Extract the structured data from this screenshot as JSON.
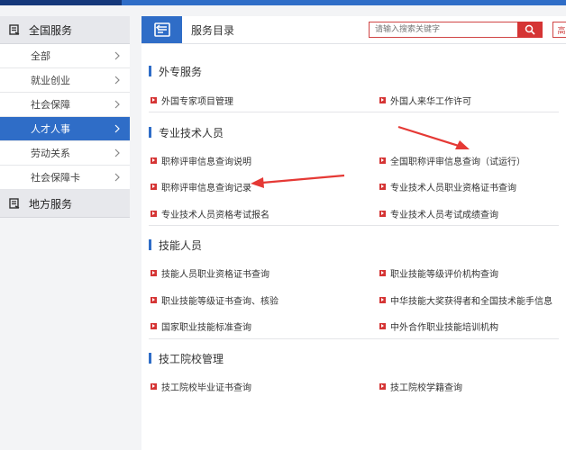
{
  "sidebar": {
    "groups": [
      {
        "label": "全国服务",
        "items": [
          "全部",
          "就业创业",
          "社会保障",
          "人才人事",
          "劳动关系",
          "社会保障卡"
        ]
      },
      {
        "label": "地方服务"
      }
    ],
    "active_item": "人才人事"
  },
  "header": {
    "title": "服务目录",
    "search_placeholder": "请输入搜索关键字",
    "right_button_label": "高"
  },
  "sections": [
    {
      "title": "外专服务",
      "links": [
        "外国专家项目管理",
        "外国人来华工作许可"
      ]
    },
    {
      "title": "专业技术人员",
      "links": [
        "职称评审信息查询说明",
        "全国职称评审信息查询（试运行）",
        "职称评审信息查询记录",
        "专业技术人员职业资格证书查询",
        "专业技术人员资格考试报名",
        "专业技术人员考试成绩查询"
      ]
    },
    {
      "title": "技能人员",
      "links": [
        "技能人员职业资格证书查询",
        "职业技能等级评价机构查询",
        "职业技能等级证书查询、核验",
        "中华技能大奖获得者和全国技术能手信息",
        "国家职业技能标准查询",
        "中外合作职业技能培训机构"
      ]
    },
    {
      "title": "技工院校管理",
      "links": [
        "技工院校毕业证书查询",
        "技工院校学籍查询"
      ]
    }
  ],
  "colors": {
    "primary": "#2f6dc7",
    "accent": "#d53434",
    "annotation_arrow": "#e53935"
  },
  "icons": {
    "service_catalog": "catalog-icon",
    "search": "search-icon",
    "group": "service-group-icon",
    "chevron": "chevron-right-icon"
  }
}
